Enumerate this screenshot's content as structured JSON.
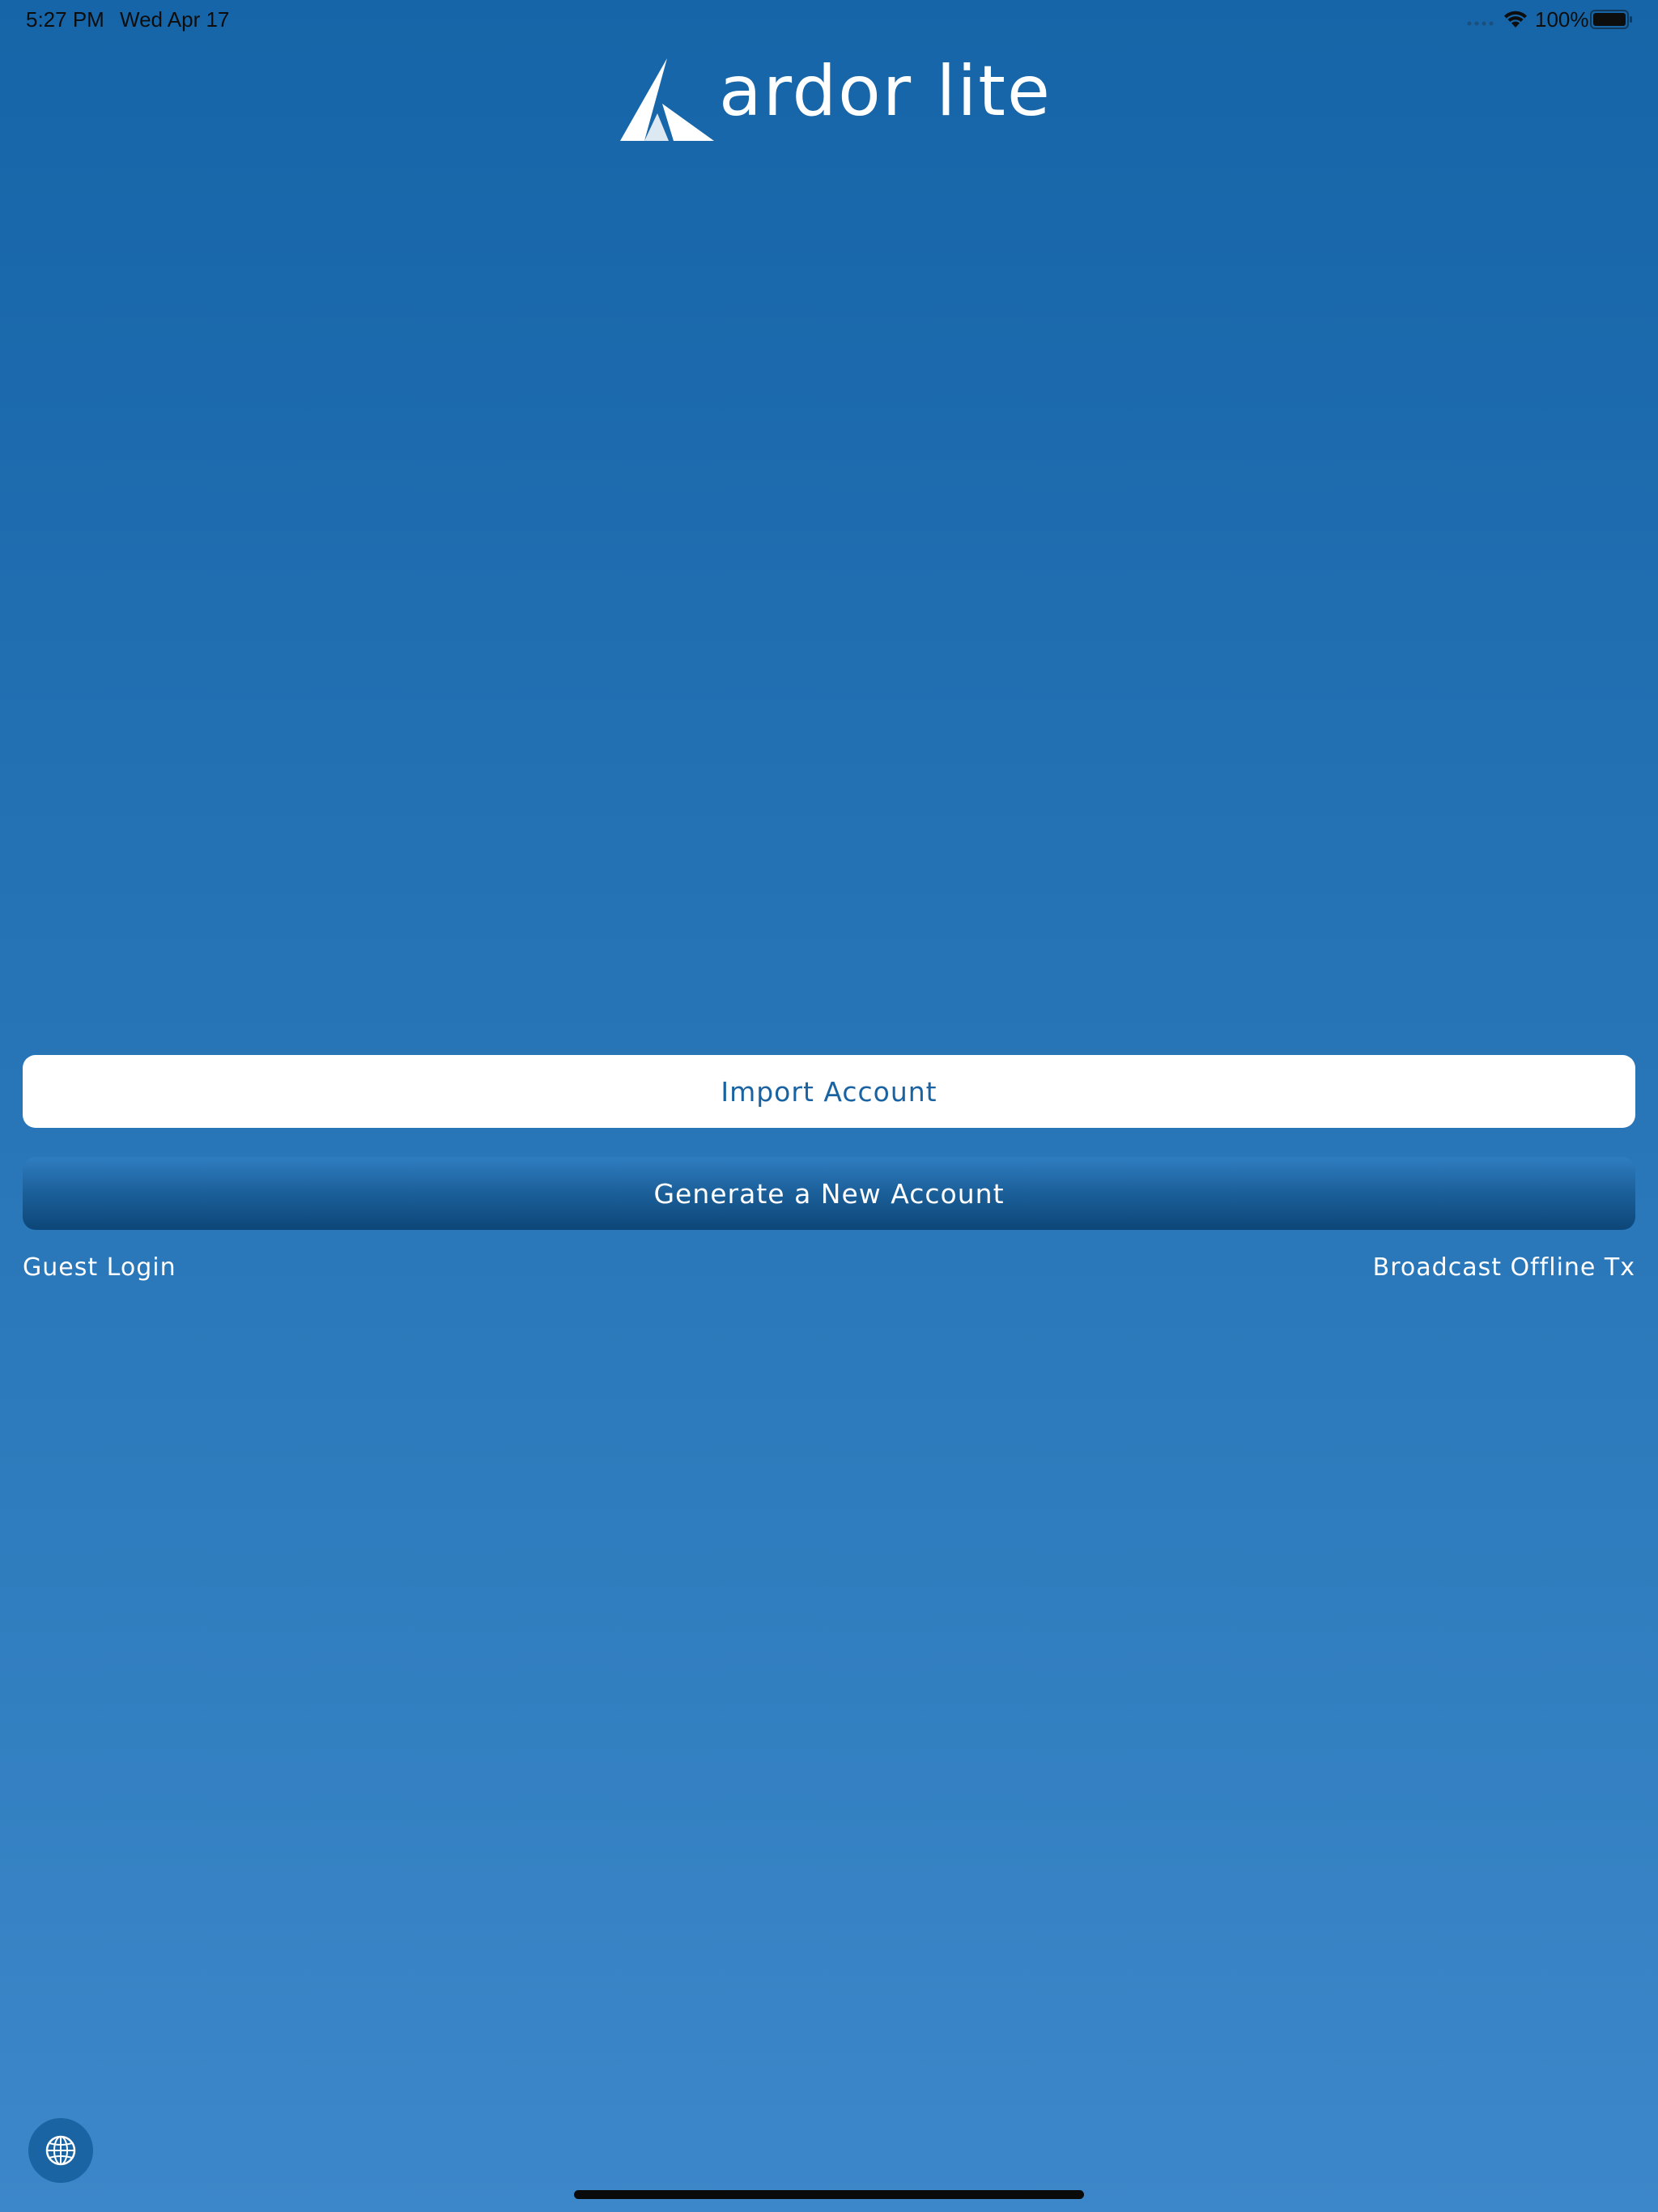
{
  "status_bar": {
    "time": "5:27 PM",
    "date": "Wed Apr 17",
    "battery_percent": "100%",
    "icons": [
      "signal-dots-icon",
      "wifi-icon",
      "battery-icon"
    ]
  },
  "logo": {
    "text": "ardor lite",
    "icon": "ardor-logo-icon"
  },
  "actions": {
    "import_label": "Import Account",
    "generate_label": "Generate a New Account",
    "guest_label": "Guest Login",
    "broadcast_label": "Broadcast Offline Tx"
  },
  "language_button": {
    "icon": "globe-icon"
  },
  "colors": {
    "background_top": "#1565a8",
    "background_bottom": "#3c87c9",
    "accent_text": "#1a63a2",
    "generate_button_dark": "#0d4678"
  }
}
